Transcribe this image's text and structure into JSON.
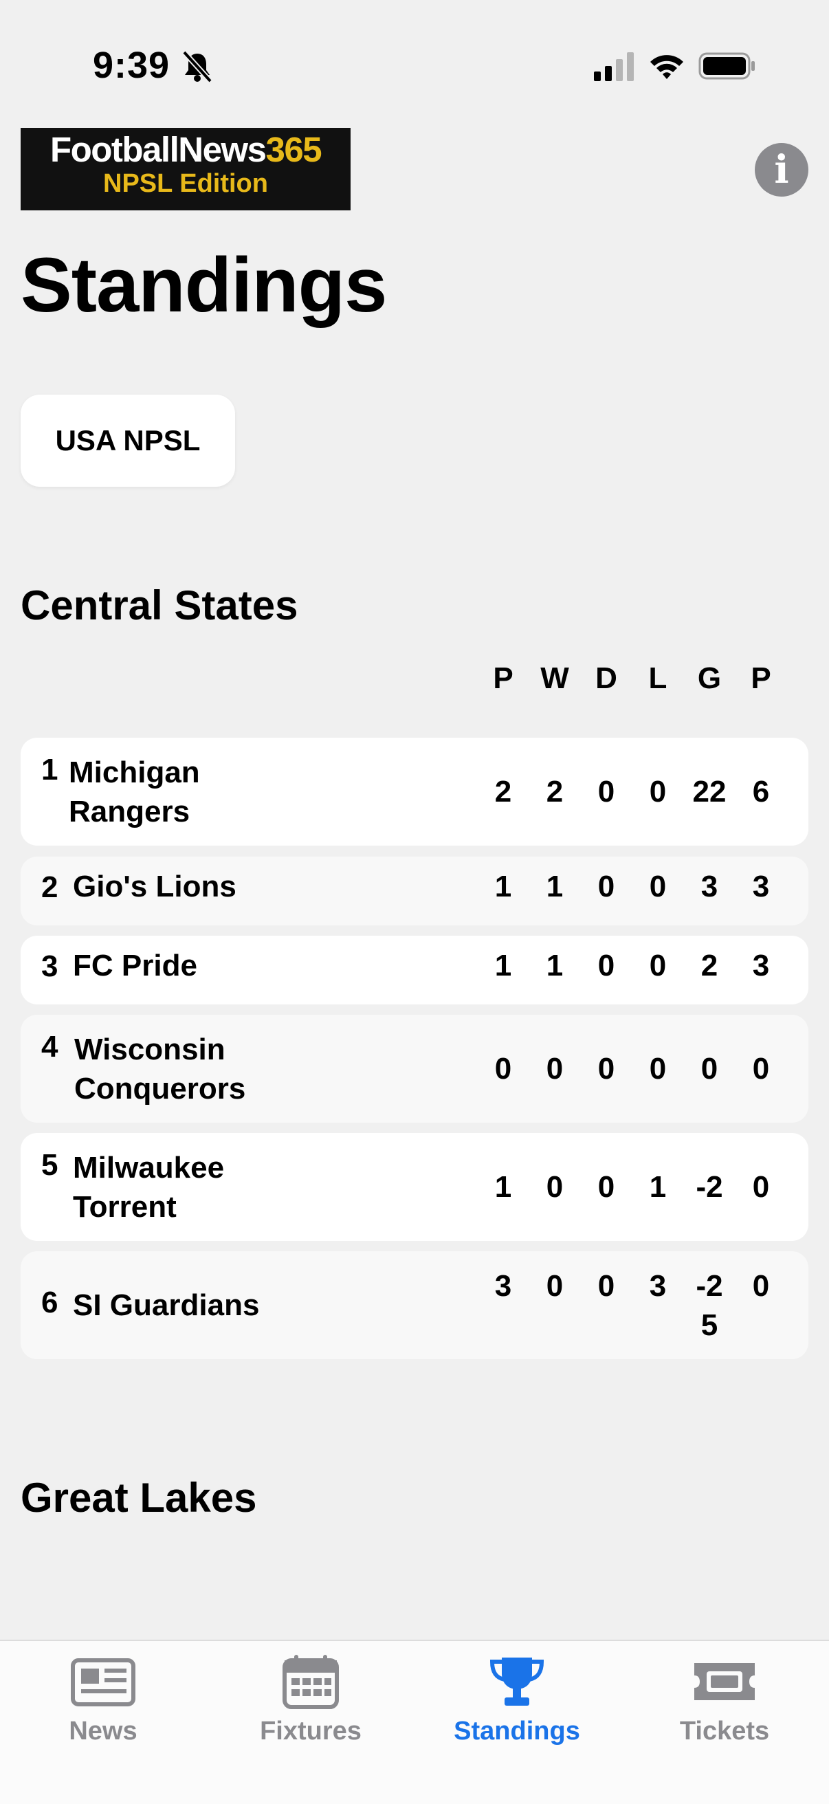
{
  "status_bar": {
    "time": "9:39"
  },
  "header": {
    "logo_main": "FootballNews",
    "logo_number": "365",
    "logo_edition": "NPSL Edition",
    "title": "Standings"
  },
  "league_selector": {
    "label": "USA NPSL"
  },
  "sections": [
    {
      "title": "Central States",
      "columns": [
        "P",
        "W",
        "D",
        "L",
        "G",
        "P"
      ],
      "rows": [
        {
          "rank": "1",
          "team": "Michigan Rangers",
          "p": "2",
          "w": "2",
          "d": "0",
          "l": "0",
          "g": "22",
          "pts": "6"
        },
        {
          "rank": "2",
          "team": "Gio's Lions",
          "p": "1",
          "w": "1",
          "d": "0",
          "l": "0",
          "g": "3",
          "pts": "3"
        },
        {
          "rank": "3",
          "team": "FC Pride",
          "p": "1",
          "w": "1",
          "d": "0",
          "l": "0",
          "g": "2",
          "pts": "3"
        },
        {
          "rank": "4",
          "team": "Wisconsin Conquerors",
          "p": "0",
          "w": "0",
          "d": "0",
          "l": "0",
          "g": "0",
          "pts": "0"
        },
        {
          "rank": "5",
          "team": "Milwaukee Torrent",
          "p": "1",
          "w": "0",
          "d": "0",
          "l": "1",
          "g": "-2",
          "pts": "0"
        },
        {
          "rank": "6",
          "team": "SI Guardians",
          "p": "3",
          "w": "0",
          "d": "0",
          "l": "3",
          "g": "-25",
          "pts": "0"
        }
      ]
    },
    {
      "title": "Great Lakes"
    }
  ],
  "tab_bar": {
    "tabs": [
      {
        "label": "News",
        "icon": "newspaper-icon"
      },
      {
        "label": "Fixtures",
        "icon": "calendar-icon"
      },
      {
        "label": "Standings",
        "icon": "trophy-icon",
        "active": true
      },
      {
        "label": "Tickets",
        "icon": "ticket-icon"
      }
    ]
  },
  "colors": {
    "accent": "#1a73e8",
    "logo_gold": "#e8b91a",
    "inactive": "#8a8a8e"
  }
}
